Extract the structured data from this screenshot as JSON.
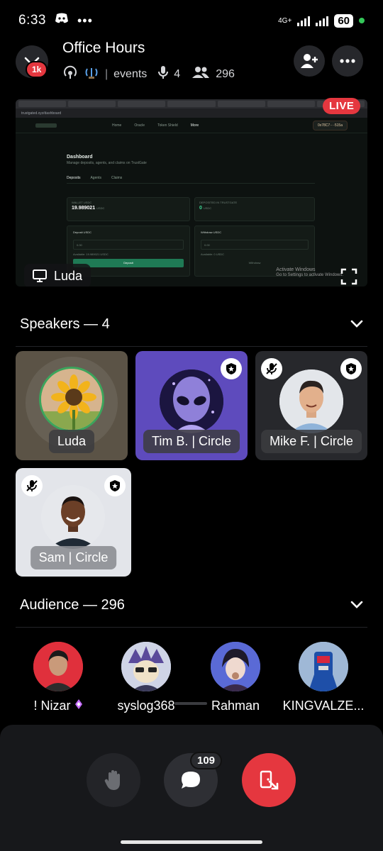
{
  "status_bar": {
    "time": "6:33",
    "network": "4G+",
    "battery": "60"
  },
  "header": {
    "title": "Office Hours",
    "notification_badge": "1k",
    "channel": "events",
    "speaker_count": "4",
    "listener_count": "296"
  },
  "stream": {
    "live_label": "LIVE",
    "sharer_name": "Luda",
    "url": "trustgated.xyz/dashboard",
    "nav_items": [
      "Home",
      "Oracle",
      "Token Shield",
      "More"
    ],
    "wallet_address": "0x78C7····515a",
    "dashboard_title": "Dashboard",
    "dashboard_subtitle": "Manage deposits, agents, and claims on TrustGate",
    "dashboard_tabs": [
      "Deposits",
      "Agents",
      "Claims"
    ],
    "wallet_usdc_label": "WALLET USDC",
    "wallet_usdc_value": "19.989021",
    "wallet_usdc_unit": "USDC",
    "deposited_label": "DEPOSITED IN TRUSTGATE",
    "deposited_value": "0",
    "deposited_unit": "USDC",
    "deposit_label": "Deposit USDC",
    "withdraw_label": "Withdraw USDC",
    "deposit_placeholder": "0.00",
    "withdraw_placeholder": "0.00",
    "deposit_available": "Available: 19.989021 USDC",
    "withdraw_available": "Available: 0 USDC",
    "deposit_button": "Deposit",
    "withdraw_button": "Withdraw",
    "watermark_line1": "Activate Windows",
    "watermark_line2": "Go to Settings to activate Windows."
  },
  "speakers": {
    "heading": "Speakers — 4",
    "items": [
      {
        "name": "Luda"
      },
      {
        "name": "Tim B. | Circle"
      },
      {
        "name": "Mike F. | Circle"
      },
      {
        "name": "Sam | Circle"
      }
    ]
  },
  "audience": {
    "heading": "Audience — 296",
    "members": [
      {
        "name": "! Nizar"
      },
      {
        "name": "syslog368"
      },
      {
        "name": "Rahman"
      },
      {
        "name": "KINGVALZE..."
      }
    ]
  },
  "controls": {
    "chat_count": "109"
  },
  "colors": {
    "live_red": "#e5373f",
    "purple_tile": "#5e4bbd",
    "leave_red": "#e5373f",
    "background": "#000000"
  }
}
